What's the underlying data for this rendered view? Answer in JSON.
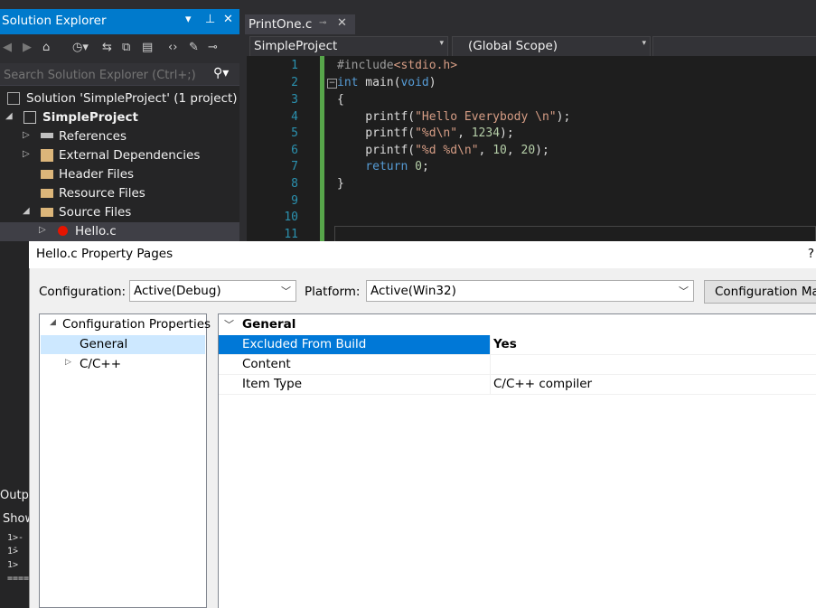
{
  "solution_explorer": {
    "title": "Solution Explorer",
    "search_placeholder": "Search Solution Explorer (Ctrl+;)",
    "tree": [
      {
        "label": "Solution 'SimpleProject' (1 project)"
      },
      {
        "label": "SimpleProject"
      },
      {
        "label": "References"
      },
      {
        "label": "External Dependencies"
      },
      {
        "label": "Header Files"
      },
      {
        "label": "Resource Files"
      },
      {
        "label": "Source Files"
      },
      {
        "label": "Hello.c"
      }
    ]
  },
  "editor": {
    "tab_label": "PrintOne.c",
    "project_combo": "SimpleProject",
    "scope_combo": "(Global Scope)",
    "line_numbers": [
      "1",
      "2",
      "3",
      "4",
      "5",
      "6",
      "7",
      "8",
      "9",
      "10",
      "11"
    ],
    "code": {
      "l1_pp": "#include",
      "l1_inc": "<stdio.h>",
      "l2_kw": "int",
      "l2_rest": " main(",
      "l2_kw2": "void",
      "l2_end": ")",
      "l3": "{",
      "l4_a": "    printf(",
      "l4_str": "\"Hello Everybody \\n\"",
      "l4_b": ");",
      "l5_a": "    printf(",
      "l5_str": "\"%d\\n\"",
      "l5_b": ", ",
      "l5_num": "1234",
      "l5_c": ");",
      "l6_a": "    printf(",
      "l6_str": "\"%d %d\\n\"",
      "l6_b": ", ",
      "l6_num1": "10",
      "l6_c": ", ",
      "l6_num2": "20",
      "l6_d": ");",
      "l7_kw": "    return",
      "l7_sp": " ",
      "l7_num": "0",
      "l7_end": ";",
      "l8": "}"
    }
  },
  "output_panel": {
    "title_fragment": "Outp",
    "show_fragment": "Show",
    "lines": [
      "1>---",
      "1>",
      "1>",
      "===="
    ]
  },
  "dialog": {
    "title": "Hello.c Property Pages",
    "help": "?",
    "configuration_label": "Configuration:",
    "configuration_value": "Active(Debug)",
    "platform_label": "Platform:",
    "platform_value": "Active(Win32)",
    "config_manager_button": "Configuration Manager...",
    "nav": [
      {
        "label": "Configuration Properties"
      },
      {
        "label": "General"
      },
      {
        "label": "C/C++"
      }
    ],
    "category": "General",
    "properties": [
      {
        "name": "Excluded From Build",
        "value": "Yes"
      },
      {
        "name": "Content",
        "value": ""
      },
      {
        "name": "Item Type",
        "value": "C/C++ compiler"
      }
    ]
  },
  "colors": {
    "accent": "#007acc",
    "selection": "#0078d7",
    "nav_selection": "#cde8ff",
    "change_bar": "#57a64a"
  }
}
